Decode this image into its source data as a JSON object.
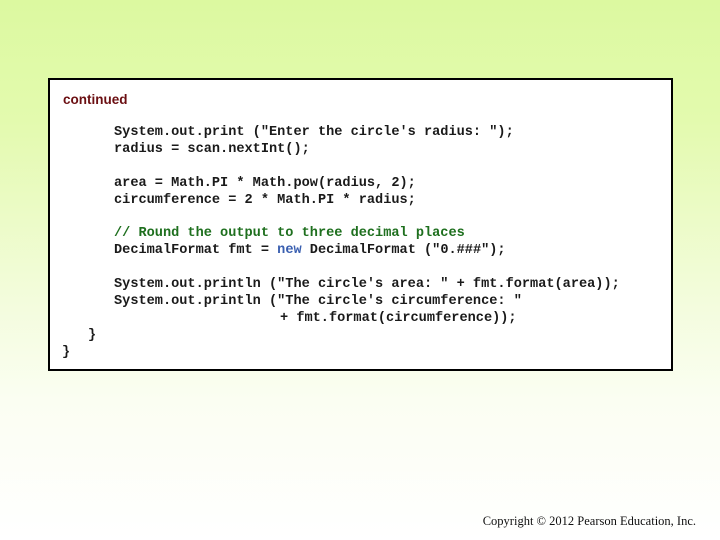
{
  "slide": {
    "continued_label": "continued",
    "code_lines": [
      {
        "id": "print-prompt",
        "text": "System.out.print (\"Enter the circle's radius: \");"
      },
      {
        "id": "read-radius",
        "text": "radius = scan.nextInt();"
      },
      {
        "id": "area-calc",
        "text": "area = Math.PI * Math.pow(radius, 2);"
      },
      {
        "id": "circumference-calc",
        "text": "circumference = 2 * Math.PI * radius;"
      },
      {
        "id": "comment",
        "text": "// Round the output to three decimal places"
      },
      {
        "id": "decimal-format-pre",
        "text": "DecimalFormat fmt = "
      },
      {
        "id": "decimal-format-keyword",
        "text": "new"
      },
      {
        "id": "decimal-format-post",
        "text": " DecimalFormat (\"0.###\");"
      },
      {
        "id": "println-area",
        "text": "System.out.println (\"The circle's area: \" + fmt.format(area));"
      },
      {
        "id": "println-circ",
        "text": "System.out.println (\"The circle's circumference: \""
      },
      {
        "id": "println-circ-cont",
        "text": "+ fmt.format(circumference));"
      },
      {
        "id": "close-method",
        "text": "}"
      },
      {
        "id": "close-class",
        "text": "}"
      }
    ],
    "copyright": "Copyright © 2012 Pearson Education, Inc."
  },
  "colors": {
    "continued": "#6b0f12",
    "comment": "#1e6f1e",
    "keyword": "#3a5fb0"
  }
}
